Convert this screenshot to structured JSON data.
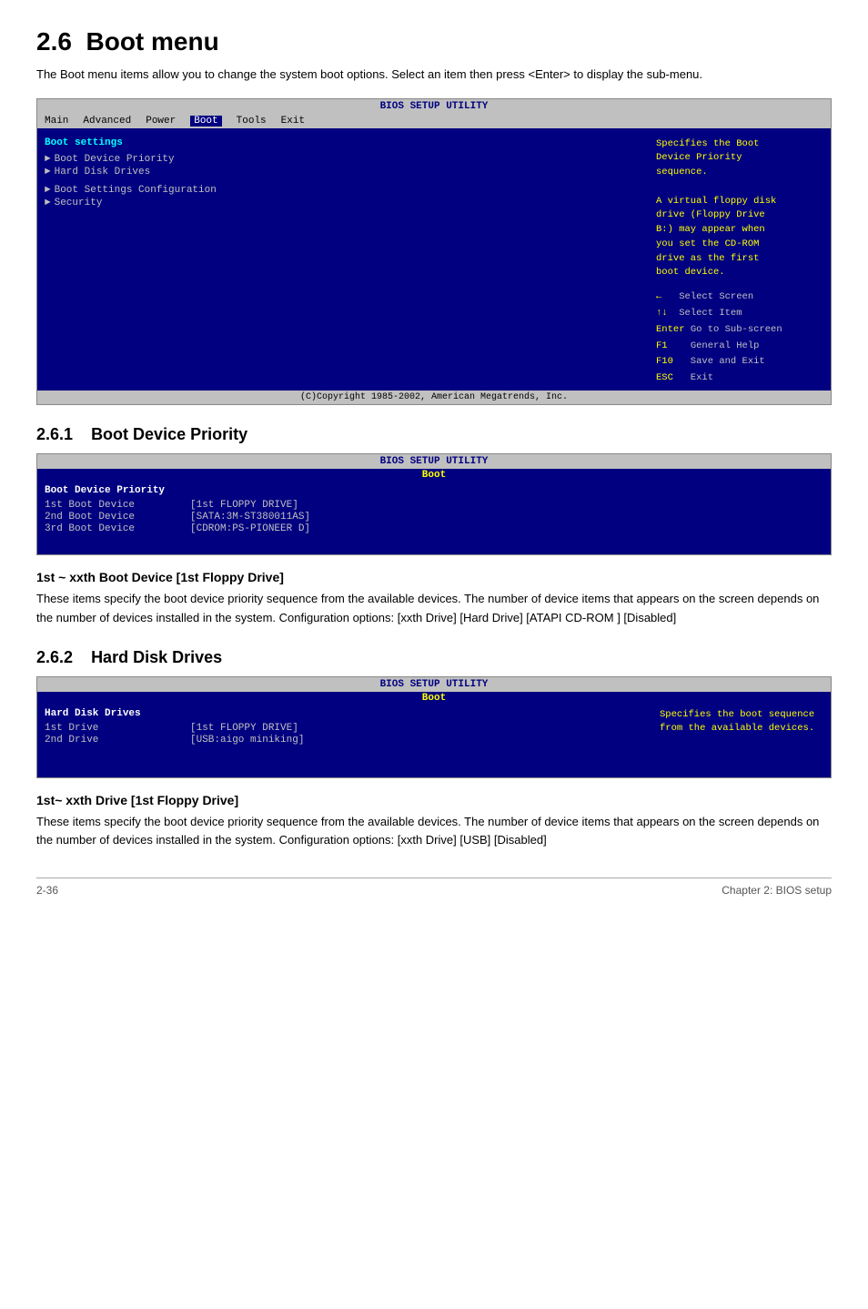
{
  "page": {
    "section": "2.6",
    "title": "Boot menu",
    "intro": "The Boot menu items allow you to change the system boot options. Select an item then press <Enter> to display the sub-menu.",
    "bios_main": {
      "header": "BIOS SETUP UTILITY",
      "nav": [
        "Main",
        "Advanced",
        "Power",
        "Boot",
        "Tools",
        "Exit"
      ],
      "active_nav": "Boot",
      "section_label": "Boot settings",
      "menu_items": [
        "Boot Device Priority",
        "Hard Disk Drives",
        "Boot Settings Configuration",
        "Security"
      ],
      "help_title": "Specifies the Boot Device Priority sequence.",
      "help_body": "A virtual floppy disk drive (Floppy Drive B:) may appear when you set the CD-ROM drive as the first boot device.",
      "keys": [
        {
          "key": "←",
          "desc": "Select Screen"
        },
        {
          "key": "↑↓",
          "desc": "Select Item"
        },
        {
          "key": "Enter",
          "desc": "Go to Sub-screen"
        },
        {
          "key": "F1",
          "desc": "General Help"
        },
        {
          "key": "F10",
          "desc": "Save and Exit"
        },
        {
          "key": "ESC",
          "desc": "Exit"
        }
      ],
      "footer": "(C)Copyright 1985-2002, American Megatrends, Inc."
    },
    "subsection_261": {
      "number": "2.6.1",
      "title": "Boot Device Priority",
      "bios": {
        "header": "BIOS SETUP UTILITY",
        "subheader": "Boot",
        "section_label": "Boot Device Priority",
        "rows": [
          {
            "label": "1st Boot Device",
            "value": "[1st FLOPPY DRIVE]"
          },
          {
            "label": "2nd Boot Device",
            "value": "[SATA:3M-ST380011AS]"
          },
          {
            "label": "3rd Boot Device",
            "value": "[CDROM:PS-PIONEER D]"
          }
        ]
      },
      "subsubsection": {
        "title": "1st ~ xxth Boot Device [1st Floppy Drive]",
        "body": "These items specify the boot device priority sequence from the available devices. The number of device items that appears on the screen depends on the number of devices installed in the system. Configuration options: [xxth Drive] [Hard Drive] [ATAPI CD-ROM ] [Disabled]"
      }
    },
    "subsection_262": {
      "number": "2.6.2",
      "title": "Hard Disk Drives",
      "bios": {
        "header": "BIOS SETUP UTILITY",
        "subheader": "Boot",
        "section_label": "Hard Disk Drives",
        "rows": [
          {
            "label": "1st Drive",
            "value": "[1st FLOPPY DRIVE]"
          },
          {
            "label": "2nd Drive",
            "value": "[USB:aigo miniking]"
          }
        ],
        "help": "Specifies the boot sequence from the available devices."
      }
    },
    "subsubsection_262": {
      "title": "1st~ xxth Drive [1st Floppy Drive]",
      "body": "These items specify the boot device priority sequence from the available devices. The number of device items that appears on the screen depends on the number of devices installed in the system. Configuration options: [xxth Drive] [USB] [Disabled]"
    },
    "footer": {
      "left": "2-36",
      "right": "Chapter 2: BIOS setup"
    }
  }
}
